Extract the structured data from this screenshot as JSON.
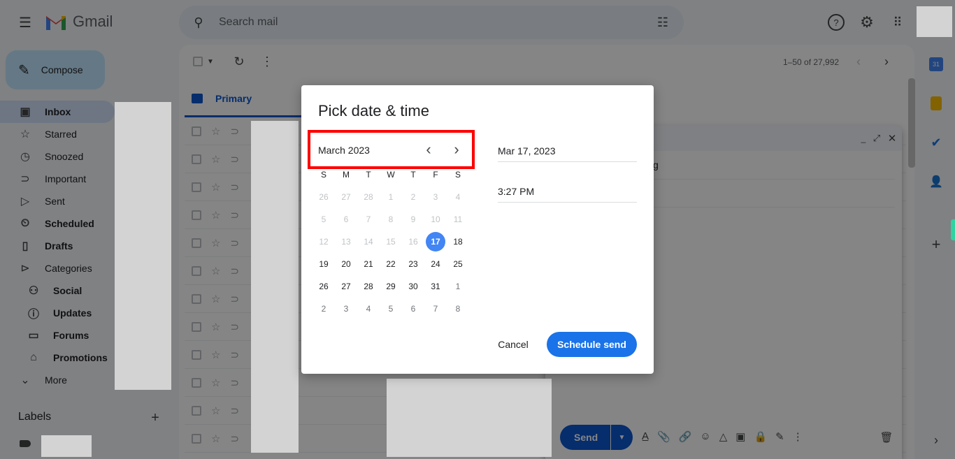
{
  "app": {
    "name": "Gmail"
  },
  "search": {
    "placeholder": "Search mail"
  },
  "compose_label": "Compose",
  "sidebar": {
    "items": [
      {
        "label": "Inbox",
        "icon": "inbox-icon",
        "bold": true,
        "active": true
      },
      {
        "label": "Starred",
        "icon": "star-icon"
      },
      {
        "label": "Snoozed",
        "icon": "clock-icon"
      },
      {
        "label": "Important",
        "icon": "important-icon"
      },
      {
        "label": "Sent",
        "icon": "send-icon"
      },
      {
        "label": "Scheduled",
        "icon": "scheduled-icon",
        "bold": true
      },
      {
        "label": "Drafts",
        "icon": "draft-icon",
        "bold": true
      },
      {
        "label": "Categories",
        "icon": "label-icon"
      },
      {
        "label": "Social",
        "icon": "people-icon",
        "bold": true,
        "sub": true
      },
      {
        "label": "Updates",
        "icon": "info-icon",
        "bold": true,
        "sub": true
      },
      {
        "label": "Forums",
        "icon": "forum-icon",
        "bold": true,
        "sub": true
      },
      {
        "label": "Promotions",
        "icon": "tag-icon",
        "bold": true,
        "sub": true
      },
      {
        "label": "More",
        "icon": "chevron-down-icon"
      }
    ],
    "labels_heading": "Labels"
  },
  "toolbar": {
    "pagination": "1–50 of 27,992"
  },
  "tabs": [
    {
      "label": "Primary"
    }
  ],
  "compose_window": {
    "subject_fragment": "g",
    "send_label": "Send"
  },
  "dialog": {
    "title": "Pick date & time",
    "month_label": "March 2023",
    "weekdays": [
      "S",
      "M",
      "T",
      "W",
      "T",
      "F",
      "S"
    ],
    "weeks": [
      [
        "26",
        "27",
        "28",
        "1",
        "2",
        "3",
        "4"
      ],
      [
        "5",
        "6",
        "7",
        "8",
        "9",
        "10",
        "11"
      ],
      [
        "12",
        "13",
        "14",
        "15",
        "16",
        "17",
        "18"
      ],
      [
        "19",
        "20",
        "21",
        "22",
        "23",
        "24",
        "25"
      ],
      [
        "26",
        "27",
        "28",
        "29",
        "30",
        "31",
        "1"
      ],
      [
        "2",
        "3",
        "4",
        "5",
        "6",
        "7",
        "8"
      ]
    ],
    "selected_day": "17",
    "date_value": "Mar 17, 2023",
    "time_value": "3:27 PM",
    "cancel_label": "Cancel",
    "schedule_label": "Schedule send"
  },
  "colors": {
    "accent": "#1a73e8",
    "selected_day": "#4285f4",
    "highlight_box": "#ff0000"
  }
}
